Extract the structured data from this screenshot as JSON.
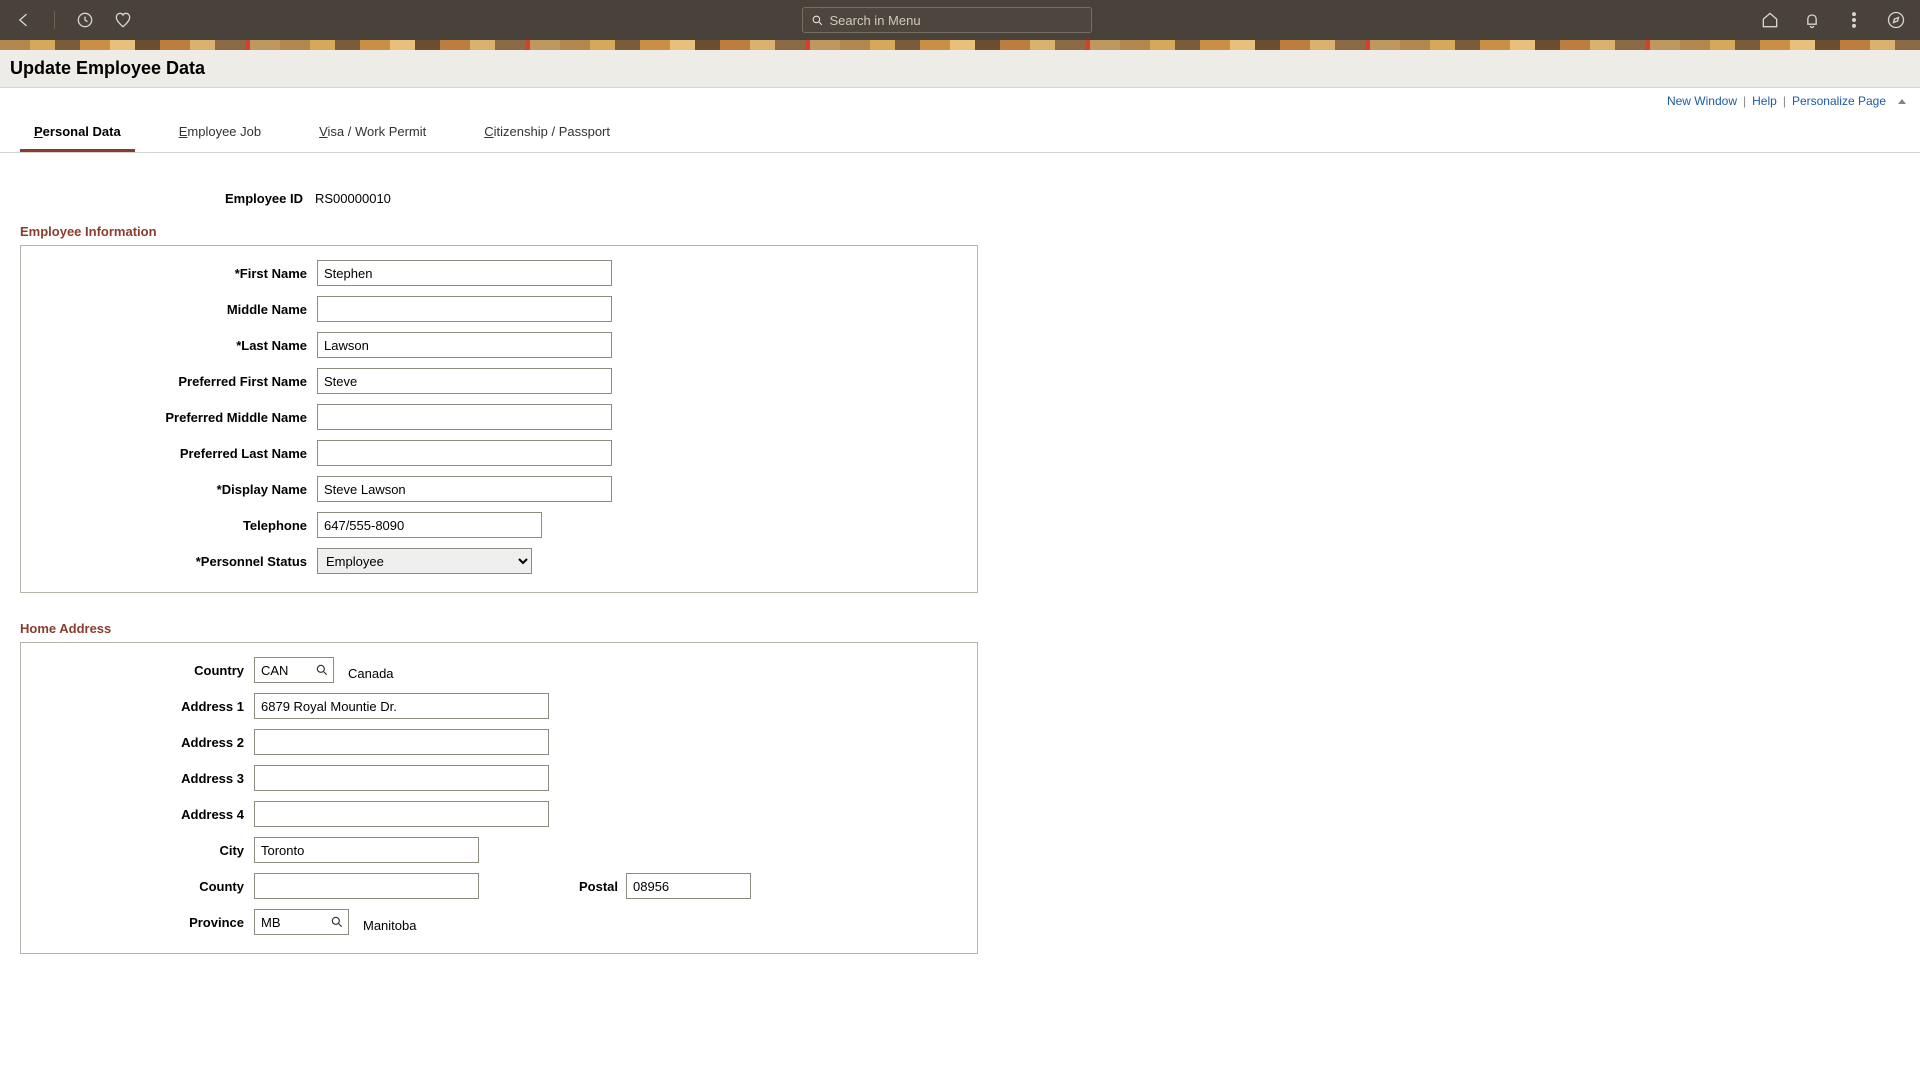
{
  "topbar": {
    "search_placeholder": "Search in Menu"
  },
  "pagetitle": "Update Employee Data",
  "pagelinks": {
    "new_window": "New Window",
    "help": "Help",
    "personalize": "Personalize Page"
  },
  "tabs": [
    {
      "label": "Personal Data",
      "hotkey": "P",
      "rest": "ersonal Data",
      "active": true
    },
    {
      "label": "Employee Job",
      "hotkey": "E",
      "rest": "mployee Job",
      "active": false
    },
    {
      "label": "Visa / Work Permit",
      "hotkey": "V",
      "rest": "isa / Work Permit",
      "active": false
    },
    {
      "label": "Citizenship / Passport",
      "hotkey": "C",
      "rest": "itizenship / Passport",
      "active": false
    }
  ],
  "employee_id": {
    "label": "Employee ID",
    "value": "RS00000010"
  },
  "section_emp_info": "Employee Information",
  "emp": {
    "first_name_label": "*First Name",
    "first_name": "Stephen",
    "middle_name_label": "Middle Name",
    "middle_name": "",
    "last_name_label": "*Last Name",
    "last_name": "Lawson",
    "pref_first_label": "Preferred First Name",
    "pref_first": "Steve",
    "pref_middle_label": "Preferred Middle Name",
    "pref_middle": "",
    "pref_last_label": "Preferred Last Name",
    "pref_last": "",
    "display_name_label": "*Display Name",
    "display_name": "Steve Lawson",
    "telephone_label": "Telephone",
    "telephone": "647/555-8090",
    "personnel_status_label": "*Personnel Status",
    "personnel_status": "Employee"
  },
  "section_home_addr": "Home Address",
  "addr": {
    "country_label": "Country",
    "country_code": "CAN",
    "country_name": "Canada",
    "address1_label": "Address 1",
    "address1": "6879 Royal Mountie Dr.",
    "address2_label": "Address 2",
    "address2": "",
    "address3_label": "Address 3",
    "address3": "",
    "address4_label": "Address 4",
    "address4": "",
    "city_label": "City",
    "city": "Toronto",
    "county_label": "County",
    "county": "",
    "postal_label": "Postal",
    "postal": "08956",
    "province_label": "Province",
    "province_code": "MB",
    "province_name": "Manitoba"
  }
}
